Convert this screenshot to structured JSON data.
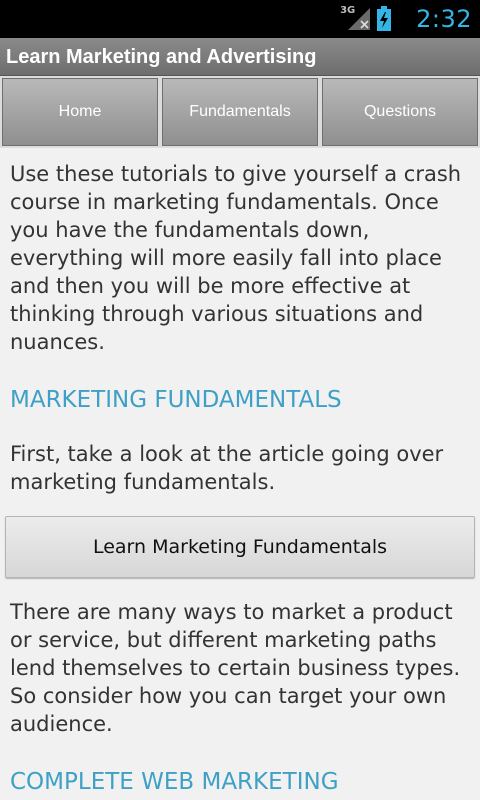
{
  "status_bar": {
    "network": "3G",
    "time": "2:32",
    "signal_icon": "signal-no-data-icon",
    "battery_icon": "battery-charging-icon"
  },
  "titlebar": {
    "title": "Learn Marketing and Advertising"
  },
  "tabs": [
    {
      "label": "Home"
    },
    {
      "label": "Fundamentals"
    },
    {
      "label": "Questions"
    }
  ],
  "content": {
    "intro": "Use these tutorials to give yourself a crash course in marketing fundamentals. Once you have the fundamentals down, everything will more easily fall into place and then you will be more effective at thinking through various situations and nuances.",
    "section1_heading": "MARKETING FUNDAMENTALS",
    "section1_text": "First, take a look at the article going over marketing fundamentals.",
    "section1_button": "Learn Marketing Fundamentals",
    "section1_text2": "There are many ways to market a product or service, but different marketing paths lend themselves to certain business types. So consider how you can target your own audience.",
    "section2_heading": "COMPLETE WEB MARKETING"
  },
  "colors": {
    "accent": "#33b5e5",
    "heading": "#3ea0c6",
    "body_text": "#333333",
    "background": "#f1f1f1"
  }
}
